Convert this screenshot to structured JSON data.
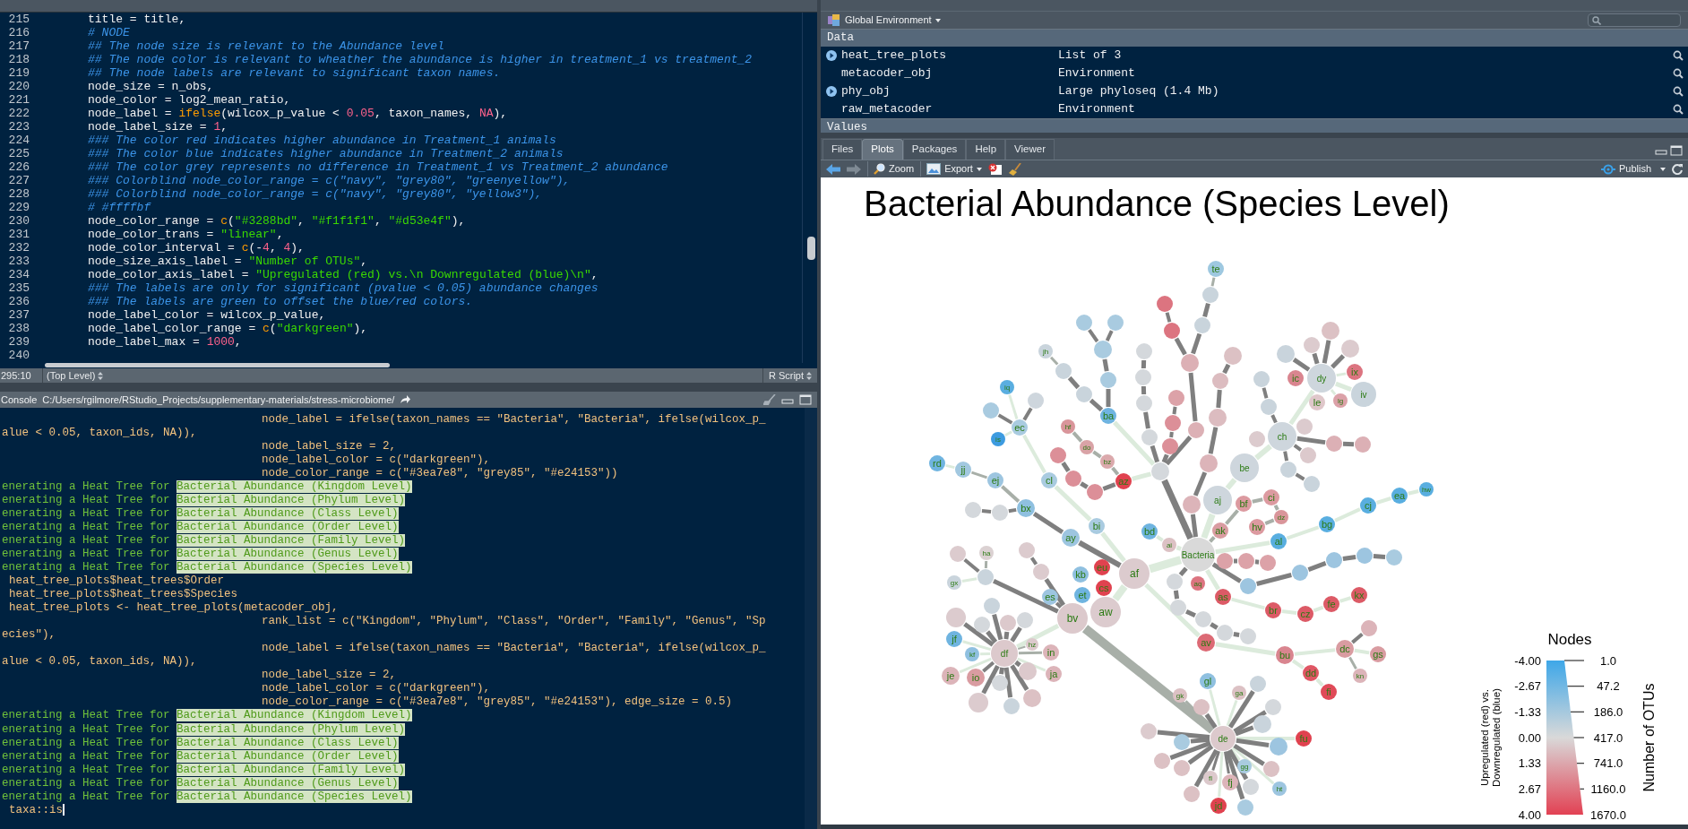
{
  "editor": {
    "lines": [
      {
        "number": "215",
        "segments": [
          {
            "text": "title = title,",
            "kind": "plain"
          }
        ]
      },
      {
        "number": "216",
        "segments": [
          {
            "text": "# NODE",
            "kind": "comment"
          }
        ]
      },
      {
        "number": "217",
        "segments": [
          {
            "text": "## The node size is relevant to the Abundance level",
            "kind": "comment"
          }
        ]
      },
      {
        "number": "218",
        "segments": [
          {
            "text": "## The node color is relevant to wheather the abundance is higher in treatment_1 vs treatment_2",
            "kind": "comment"
          }
        ]
      },
      {
        "number": "219",
        "segments": [
          {
            "text": "## The node labels are relevant to significant taxon names.",
            "kind": "comment"
          }
        ]
      },
      {
        "number": "220",
        "segments": [
          {
            "text": "node_size = n_obs,",
            "kind": "plain"
          }
        ]
      },
      {
        "number": "221",
        "segments": [
          {
            "text": "node_color = log2_mean_ratio,",
            "kind": "plain"
          }
        ]
      },
      {
        "number": "222",
        "segments": [
          {
            "text": "node_label = ",
            "kind": "plain"
          },
          {
            "text": "ifelse",
            "kind": "function"
          },
          {
            "text": "(wilcox_p_value < ",
            "kind": "plain"
          },
          {
            "text": "0.05",
            "kind": "number"
          },
          {
            "text": ", taxon_names, ",
            "kind": "plain"
          },
          {
            "text": "NA",
            "kind": "number"
          },
          {
            "text": "),",
            "kind": "plain"
          }
        ]
      },
      {
        "number": "223",
        "segments": [
          {
            "text": "node_label_size = ",
            "kind": "plain"
          },
          {
            "text": "1",
            "kind": "number"
          },
          {
            "text": ",",
            "kind": "plain"
          }
        ]
      },
      {
        "number": "224",
        "segments": [
          {
            "text": "### The color red indicates higher abundance in Treatment_1 animals",
            "kind": "comment"
          }
        ]
      },
      {
        "number": "225",
        "segments": [
          {
            "text": "### The color blue indicates higher abundance in Treatment_2 animals",
            "kind": "comment"
          }
        ]
      },
      {
        "number": "226",
        "segments": [
          {
            "text": "### The color grey represents no difference in Treatment_1 vs Treatment_2 abundance",
            "kind": "comment"
          }
        ]
      },
      {
        "number": "227",
        "segments": [
          {
            "text": "### Colorblind node_color_range = c(\"navy\", \"grey80\", \"greenyellow\"),",
            "kind": "comment"
          }
        ]
      },
      {
        "number": "228",
        "segments": [
          {
            "text": "### Colorblind node_color_range = c(\"navy\", \"grey80\", \"yellow3\"),",
            "kind": "comment"
          }
        ]
      },
      {
        "number": "229",
        "segments": [
          {
            "text": "# #ffffbf",
            "kind": "comment"
          }
        ]
      },
      {
        "number": "230",
        "segments": [
          {
            "text": "node_color_range = ",
            "kind": "plain"
          },
          {
            "text": "c",
            "kind": "function"
          },
          {
            "text": "(",
            "kind": "plain"
          },
          {
            "text": "\"#3288bd\"",
            "kind": "string"
          },
          {
            "text": ", ",
            "kind": "plain"
          },
          {
            "text": "\"#f1f1f1\"",
            "kind": "string"
          },
          {
            "text": ", ",
            "kind": "plain"
          },
          {
            "text": "\"#d53e4f\"",
            "kind": "string"
          },
          {
            "text": "),",
            "kind": "plain"
          }
        ]
      },
      {
        "number": "231",
        "segments": [
          {
            "text": "node_color_trans = ",
            "kind": "plain"
          },
          {
            "text": "\"linear\"",
            "kind": "string"
          },
          {
            "text": ",",
            "kind": "plain"
          }
        ]
      },
      {
        "number": "232",
        "segments": [
          {
            "text": "node_color_interval = ",
            "kind": "plain"
          },
          {
            "text": "c",
            "kind": "function"
          },
          {
            "text": "(-",
            "kind": "plain"
          },
          {
            "text": "4",
            "kind": "number"
          },
          {
            "text": ", ",
            "kind": "plain"
          },
          {
            "text": "4",
            "kind": "number"
          },
          {
            "text": "),",
            "kind": "plain"
          }
        ]
      },
      {
        "number": "233",
        "segments": [
          {
            "text": "node_size_axis_label = ",
            "kind": "plain"
          },
          {
            "text": "\"Number of OTUs\"",
            "kind": "string"
          },
          {
            "text": ",",
            "kind": "plain"
          }
        ]
      },
      {
        "number": "234",
        "segments": [
          {
            "text": "node_color_axis_label = ",
            "kind": "plain"
          },
          {
            "text": "\"Upregulated (red) vs.\\n Downregulated (blue)\\n\"",
            "kind": "string"
          },
          {
            "text": ",",
            "kind": "plain"
          }
        ]
      },
      {
        "number": "235",
        "segments": [
          {
            "text": "### The labels are only for significant (pvalue < 0.05) abundance changes",
            "kind": "comment"
          }
        ]
      },
      {
        "number": "236",
        "segments": [
          {
            "text": "### The labels are green to offset the blue/red colors.",
            "kind": "comment"
          }
        ]
      },
      {
        "number": "237",
        "segments": [
          {
            "text": "node_label_color = wilcox_p_value,",
            "kind": "plain"
          }
        ]
      },
      {
        "number": "238",
        "segments": [
          {
            "text": "node_label_color_range = ",
            "kind": "plain"
          },
          {
            "text": "c",
            "kind": "function"
          },
          {
            "text": "(",
            "kind": "plain"
          },
          {
            "text": "\"darkgreen\"",
            "kind": "string"
          },
          {
            "text": "),",
            "kind": "plain"
          }
        ]
      },
      {
        "number": "239",
        "segments": [
          {
            "text": "node_label_max = ",
            "kind": "plain"
          },
          {
            "text": "1000",
            "kind": "number"
          },
          {
            "text": ",",
            "kind": "plain"
          }
        ]
      },
      {
        "number": "240"
      }
    ],
    "status": {
      "position": "295:10",
      "scope": "(Top Level)",
      "file_type": "R Script"
    }
  },
  "console": {
    "title": "Console",
    "path": "C:/Users/rgilmore/RStudio_Projects/supplementary-materials/stress-microbiome/",
    "lines": [
      {
        "kind": "continuation",
        "segments": [
          {
            "text": "node_label = ifelse(taxon_names == \"Bacteria\", \"Bacteria\", ifelse(wilcox_p_",
            "kind": "input"
          }
        ]
      },
      {
        "kind": "wrap",
        "segments": [
          {
            "text": "alue < 0.05, taxon_ids, NA)),",
            "kind": "input"
          }
        ]
      },
      {
        "kind": "continuation",
        "segments": [
          {
            "text": "node_label_size = 2,",
            "kind": "input"
          }
        ]
      },
      {
        "kind": "continuation",
        "segments": [
          {
            "text": "node_label_color = c(\"darkgreen\"),",
            "kind": "input"
          }
        ]
      },
      {
        "kind": "continuation",
        "segments": [
          {
            "text": "node_color_range = c(\"#3ea7e8\", \"grey85\", \"#e24153\"))",
            "kind": "input"
          }
        ]
      },
      {
        "kind": "wrap",
        "segments": [
          {
            "text": "enerating a Heat Tree for ",
            "kind": "message"
          },
          {
            "text": "Bacterial Abundance (Kingdom Level)",
            "kind": "highlight"
          }
        ]
      },
      {
        "kind": "wrap",
        "segments": [
          {
            "text": "enerating a Heat Tree for ",
            "kind": "message"
          },
          {
            "text": "Bacterial Abundance (Phylum Level)",
            "kind": "highlight"
          }
        ]
      },
      {
        "kind": "wrap",
        "segments": [
          {
            "text": "enerating a Heat Tree for ",
            "kind": "message"
          },
          {
            "text": "Bacterial Abundance (Class Level)",
            "kind": "highlight"
          }
        ]
      },
      {
        "kind": "wrap",
        "segments": [
          {
            "text": "enerating a Heat Tree for ",
            "kind": "message"
          },
          {
            "text": "Bacterial Abundance (Order Level)",
            "kind": "highlight"
          }
        ]
      },
      {
        "kind": "wrap",
        "segments": [
          {
            "text": "enerating a Heat Tree for ",
            "kind": "message"
          },
          {
            "text": "Bacterial Abundance (Family Level)",
            "kind": "highlight"
          }
        ]
      },
      {
        "kind": "wrap",
        "segments": [
          {
            "text": "enerating a Heat Tree for ",
            "kind": "message"
          },
          {
            "text": "Bacterial Abundance (Genus Level)",
            "kind": "highlight"
          }
        ]
      },
      {
        "kind": "wrap",
        "segments": [
          {
            "text": "enerating a Heat Tree for ",
            "kind": "message"
          },
          {
            "text": "Bacterial Abundance (Species Level)",
            "kind": "highlight"
          }
        ]
      },
      {
        "kind": "prompt",
        "segments": [
          {
            "text": "heat_tree_plots$heat_trees$Order",
            "kind": "input"
          }
        ]
      },
      {
        "kind": "prompt",
        "segments": [
          {
            "text": "heat_tree_plots$heat_trees$Species",
            "kind": "input"
          }
        ]
      },
      {
        "kind": "prompt",
        "segments": [
          {
            "text": "heat_tree_plots <- heat_tree_plots(metacoder_obj,",
            "kind": "input"
          }
        ]
      },
      {
        "kind": "continuation",
        "segments": [
          {
            "text": "rank_list = c(\"Kingdom\", \"Phylum\", \"Class\", \"Order\", \"Family\", \"Genus\", \"Sp",
            "kind": "input"
          }
        ]
      },
      {
        "kind": "wrap",
        "segments": [
          {
            "text": "ecies\"),",
            "kind": "input"
          }
        ]
      },
      {
        "kind": "continuation",
        "segments": [
          {
            "text": "node_label = ifelse(taxon_names == \"Bacteria\", \"Bacteria\", ifelse(wilcox_p_",
            "kind": "input"
          }
        ]
      },
      {
        "kind": "wrap",
        "segments": [
          {
            "text": "alue < 0.05, taxon_ids, NA)),",
            "kind": "input"
          }
        ]
      },
      {
        "kind": "continuation",
        "segments": [
          {
            "text": "node_label_size = 2,",
            "kind": "input"
          }
        ]
      },
      {
        "kind": "continuation",
        "segments": [
          {
            "text": "node_label_color = c(\"darkgreen\"),",
            "kind": "input"
          }
        ]
      },
      {
        "kind": "continuation",
        "segments": [
          {
            "text": "node_color_range = c(\"#3ea7e8\", \"grey85\", \"#e24153\"), edge_size = 0.5)",
            "kind": "input"
          }
        ]
      },
      {
        "kind": "wrap",
        "segments": [
          {
            "text": "enerating a Heat Tree for ",
            "kind": "message"
          },
          {
            "text": "Bacterial Abundance (Kingdom Level)",
            "kind": "highlight"
          }
        ]
      },
      {
        "kind": "wrap",
        "segments": [
          {
            "text": "enerating a Heat Tree for ",
            "kind": "message"
          },
          {
            "text": "Bacterial Abundance (Phylum Level)",
            "kind": "highlight"
          }
        ]
      },
      {
        "kind": "wrap",
        "segments": [
          {
            "text": "enerating a Heat Tree for ",
            "kind": "message"
          },
          {
            "text": "Bacterial Abundance (Class Level)",
            "kind": "highlight"
          }
        ]
      },
      {
        "kind": "wrap",
        "segments": [
          {
            "text": "enerating a Heat Tree for ",
            "kind": "message"
          },
          {
            "text": "Bacterial Abundance (Order Level)",
            "kind": "highlight"
          }
        ]
      },
      {
        "kind": "wrap",
        "segments": [
          {
            "text": "enerating a Heat Tree for ",
            "kind": "message"
          },
          {
            "text": "Bacterial Abundance (Family Level)",
            "kind": "highlight"
          }
        ]
      },
      {
        "kind": "wrap",
        "segments": [
          {
            "text": "enerating a Heat Tree for ",
            "kind": "message"
          },
          {
            "text": "Bacterial Abundance (Genus Level)",
            "kind": "highlight"
          }
        ]
      },
      {
        "kind": "wrap",
        "segments": [
          {
            "text": "enerating a Heat Tree for ",
            "kind": "message"
          },
          {
            "text": "Bacterial Abundance (Species Level)",
            "kind": "highlight"
          }
        ]
      },
      {
        "kind": "prompt",
        "segments": [
          {
            "text": "taxa::is",
            "kind": "input"
          }
        ]
      }
    ]
  },
  "environment": {
    "scope": "Global Environment",
    "sections": [
      {
        "title": "Data",
        "rows": [
          {
            "name": "heat_tree_plots",
            "value": "List of 3",
            "expandable": true
          },
          {
            "name": "metacoder_obj",
            "value": "Environment",
            "expandable": false
          },
          {
            "name": "phy_obj",
            "value": "Large phyloseq (1.4 Mb)",
            "expandable": true
          },
          {
            "name": "raw_metacoder",
            "value": "Environment",
            "expandable": false
          }
        ]
      },
      {
        "title": "Values"
      }
    ]
  },
  "viewer": {
    "tabs": [
      {
        "label": "Files",
        "selected": false
      },
      {
        "label": "Plots",
        "selected": true
      },
      {
        "label": "Packages",
        "selected": false
      },
      {
        "label": "Help",
        "selected": false
      },
      {
        "label": "Viewer",
        "selected": false
      }
    ],
    "toolbar": {
      "zoom": "Zoom",
      "export": "Export",
      "publish": "Publish"
    },
    "plot": {
      "title": "Bacterial Abundance (Species Level)",
      "tree_nodes": [
        {
          "label": "te",
          "color": "#9ec8e0"
        },
        {
          "label": "jh",
          "color": "#c9d4dc"
        },
        {
          "label": "iq",
          "color": "#5aaee0"
        },
        {
          "label": "ec",
          "color": "#a9cbe0"
        },
        {
          "label": "is",
          "color": "#3d9be0"
        },
        {
          "label": "ba",
          "color": "#6fb4e0"
        },
        {
          "label": "hf",
          "color": "#d9959a"
        },
        {
          "label": "do",
          "color": "#d9a3a6"
        },
        {
          "label": "bz",
          "color": "#dba9ac"
        },
        {
          "label": "az",
          "color": "#e0424f"
        },
        {
          "label": "rd",
          "color": "#6fb4e0"
        },
        {
          "label": "jj",
          "color": "#a2c8e0"
        },
        {
          "label": "ej",
          "color": "#9dc5e0"
        },
        {
          "label": "cl",
          "color": "#a9cbe0"
        },
        {
          "label": "bx",
          "color": "#8fc0e0"
        },
        {
          "label": "bi",
          "color": "#a9cbe0"
        },
        {
          "label": "ay",
          "color": "#9dc5e0"
        },
        {
          "label": "bd",
          "color": "#6fb4e0"
        },
        {
          "label": "ai",
          "color": "#dcc1c4"
        },
        {
          "label": "Bacteria",
          "color": "#d9d9d9"
        },
        {
          "label": "aj",
          "color": "#ced6dd"
        },
        {
          "label": "be",
          "color": "#ced6dd"
        },
        {
          "label": "bf",
          "color": "#dc9aa0"
        },
        {
          "label": "ak",
          "color": "#d99ca1"
        },
        {
          "label": "ci",
          "color": "#dc9aa0"
        },
        {
          "label": "dz",
          "color": "#d9959a"
        },
        {
          "label": "hv",
          "color": "#dc9aa0"
        },
        {
          "label": "al",
          "color": "#59aee0"
        },
        {
          "label": "bg",
          "color": "#59aee0"
        },
        {
          "label": "cj",
          "color": "#59aee0"
        },
        {
          "label": "ea",
          "color": "#59aee0"
        },
        {
          "label": "hw",
          "color": "#59aee0"
        },
        {
          "label": "ch",
          "color": "#ced6dd"
        },
        {
          "label": "dy",
          "color": "#ced6dd"
        },
        {
          "label": "ic",
          "color": "#d9858f"
        },
        {
          "label": "ix",
          "color": "#dc7480"
        },
        {
          "label": "iv",
          "color": "#c9d4dc"
        },
        {
          "label": "le",
          "color": "#dfc7ca"
        },
        {
          "label": "lg",
          "color": "#dba1a8"
        },
        {
          "label": "af",
          "color": "#dccbce"
        },
        {
          "label": "eu",
          "color": "#e0424f"
        },
        {
          "label": "cs",
          "color": "#e0424f"
        },
        {
          "label": "aw",
          "color": "#dccbce"
        },
        {
          "label": "aq",
          "color": "#dc7480"
        },
        {
          "label": "as",
          "color": "#dc5a66"
        },
        {
          "label": "br",
          "color": "#dc5a66"
        },
        {
          "label": "cz",
          "color": "#dc5a66"
        },
        {
          "label": "fe",
          "color": "#dc5a66"
        },
        {
          "label": "kx",
          "color": "#dc5a66"
        },
        {
          "label": "kb",
          "color": "#8fc0e0"
        },
        {
          "label": "es",
          "color": "#9dc5e0"
        },
        {
          "label": "et",
          "color": "#6fb4e0"
        },
        {
          "label": "bv",
          "color": "#dcc9cc"
        },
        {
          "label": "av",
          "color": "#dc6a75"
        },
        {
          "label": "bu",
          "color": "#d9858f"
        },
        {
          "label": "dc",
          "color": "#d99ca1"
        },
        {
          "label": "gs",
          "color": "#d99ca1"
        },
        {
          "label": "kn",
          "color": "#dcb4b9"
        },
        {
          "label": "dd",
          "color": "#e05664"
        },
        {
          "label": "fi",
          "color": "#e04a58"
        },
        {
          "label": "ha",
          "color": "#dbd1d2"
        },
        {
          "label": "gx",
          "color": "#c9d4dc"
        },
        {
          "label": "df",
          "color": "#dcc9cc"
        },
        {
          "label": "jf",
          "color": "#6fb4e0"
        },
        {
          "label": "kf",
          "color": "#8fc0e0"
        },
        {
          "label": "hz",
          "color": "#dcc9cc"
        },
        {
          "label": "in",
          "color": "#dcb4b9"
        },
        {
          "label": "je",
          "color": "#dcb4b9"
        },
        {
          "label": "io",
          "color": "#d99ca1"
        },
        {
          "label": "ja",
          "color": "#dcb4b9"
        },
        {
          "label": "gl",
          "color": "#8fc0e0"
        },
        {
          "label": "gk",
          "color": "#dcc1c4"
        },
        {
          "label": "ga",
          "color": "#dcc1c4"
        },
        {
          "label": "de",
          "color": "#dcc9cc"
        },
        {
          "label": "gg",
          "color": "#a9cbe0"
        },
        {
          "label": "fl",
          "color": "#dcc9cc"
        },
        {
          "label": "fj",
          "color": "#dcb4b9"
        },
        {
          "label": "jd",
          "color": "#e0424f"
        },
        {
          "label": "ht",
          "color": "#9dc5e0"
        },
        {
          "label": "fu",
          "color": "#e0424f"
        }
      ],
      "legend": {
        "title": "Nodes",
        "color_label": [
          "Upregulated (red) vs.",
          "Downregulated (blue)"
        ],
        "color_ticks": [
          "-4.00",
          "-2.67",
          "-1.33",
          "0.00",
          "1.33",
          "2.67",
          "4.00"
        ],
        "size_label": "Number of OTUs",
        "size_ticks": [
          "1.0",
          "47.2",
          "186.0",
          "417.0",
          "741.0",
          "1160.0",
          "1670.0"
        ]
      }
    }
  }
}
